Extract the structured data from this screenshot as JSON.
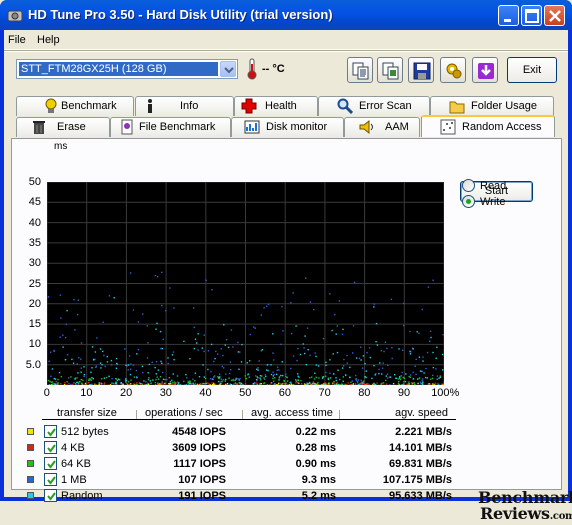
{
  "window": {
    "title": "HD Tune Pro 3.50 - Hard Disk Utility (trial version)"
  },
  "menu": {
    "file": "File",
    "help": "Help"
  },
  "toolbar": {
    "drive": "STT_FTM28GX25H (128 GB)",
    "temperature": "-- °C",
    "exit_label": "Exit",
    "icons": [
      "copy-text-icon",
      "copy-screen-icon",
      "save-icon",
      "options-icon",
      "update-icon"
    ]
  },
  "tabs": {
    "row1": [
      {
        "label": "Benchmark",
        "icon": "benchmark-icon"
      },
      {
        "label": "Info",
        "icon": "info-icon"
      },
      {
        "label": "Health",
        "icon": "health-icon"
      },
      {
        "label": "Error Scan",
        "icon": "error-scan-icon"
      },
      {
        "label": "Folder Usage",
        "icon": "folder-icon"
      }
    ],
    "row2": [
      {
        "label": "Erase",
        "icon": "erase-icon"
      },
      {
        "label": "File Benchmark",
        "icon": "file-benchmark-icon"
      },
      {
        "label": "Disk monitor",
        "icon": "disk-monitor-icon"
      },
      {
        "label": "AAM",
        "icon": "aam-icon"
      },
      {
        "label": "Random Access",
        "icon": "random-access-icon"
      }
    ],
    "active": "Random Access"
  },
  "controls": {
    "start_label": "Start",
    "read_label": "Read",
    "write_label": "Write",
    "selected": "Write"
  },
  "chart_data": {
    "type": "scatter",
    "ylabel": "ms",
    "y_ticks": [
      "50",
      "45",
      "40",
      "35",
      "30",
      "25",
      "20",
      "15",
      "10",
      "5.0"
    ],
    "x_ticks": [
      "0",
      "10",
      "20",
      "30",
      "40",
      "50",
      "60",
      "70",
      "80",
      "90",
      "100%"
    ],
    "xlim": [
      0,
      100
    ],
    "ylim": [
      0,
      50
    ],
    "grid": true,
    "series": [
      {
        "name": "512 bytes",
        "color": "#E8E800",
        "mean_ms": 0.22
      },
      {
        "name": "4 KB",
        "color": "#E02020",
        "mean_ms": 0.28
      },
      {
        "name": "64 KB",
        "color": "#20C020",
        "mean_ms": 0.9
      },
      {
        "name": "1 MB",
        "color": "#3060E0",
        "mean_ms": 9.3
      },
      {
        "name": "Random",
        "color": "#20D0E0",
        "mean_ms": 5.2
      }
    ]
  },
  "table": {
    "headers": [
      "transfer size",
      "operations / sec",
      "avg. access time",
      "agv. speed"
    ],
    "rows": [
      {
        "size": "512 bytes",
        "iops": "4548 IOPS",
        "access": "0.22 ms",
        "speed": "2.221 MB/s",
        "color": "#E8E800"
      },
      {
        "size": "4 KB",
        "iops": "3609 IOPS",
        "access": "0.28 ms",
        "speed": "14.101 MB/s",
        "color": "#E02020"
      },
      {
        "size": "64 KB",
        "iops": "1117 IOPS",
        "access": "0.90 ms",
        "speed": "69.831 MB/s",
        "color": "#20C020"
      },
      {
        "size": "1 MB",
        "iops": "107 IOPS",
        "access": "9.3 ms",
        "speed": "107.175 MB/s",
        "color": "#3060E0"
      },
      {
        "size": "Random",
        "iops": "191 IOPS",
        "access": "5.2 ms",
        "speed": "95.633 MB/s",
        "color": "#20D0E0"
      }
    ]
  },
  "watermark": {
    "line1": "Benchmark",
    "line2": "Reviews",
    "suffix": ".com"
  }
}
